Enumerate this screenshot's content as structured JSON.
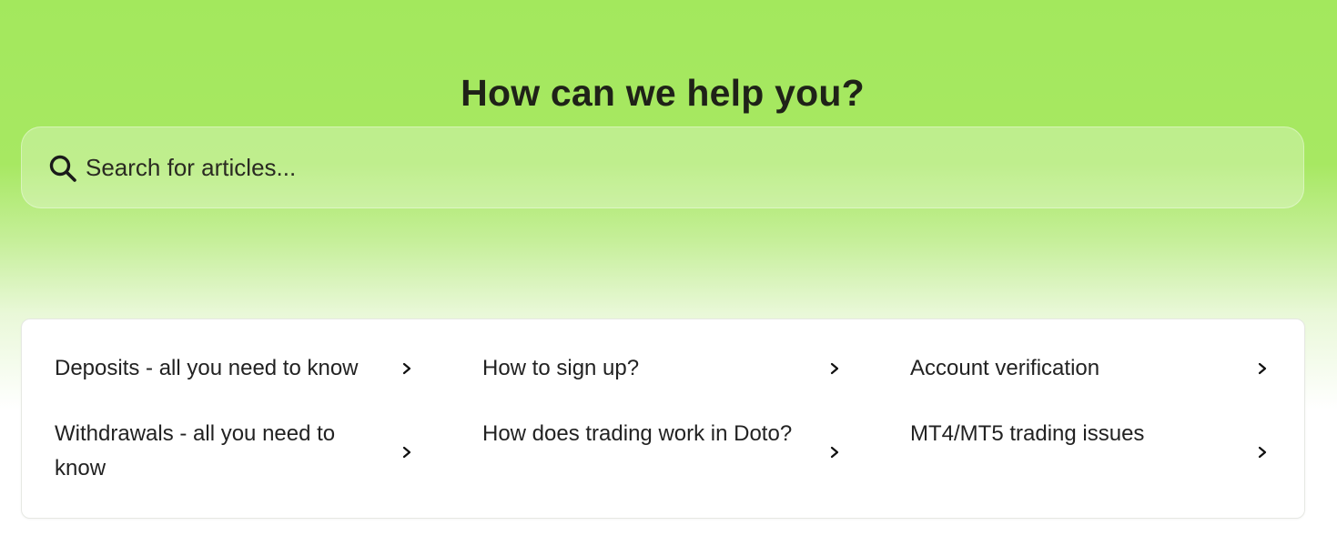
{
  "hero": {
    "title": "How can we help you?"
  },
  "search": {
    "placeholder": "Search for articles...",
    "value": "",
    "icon": "search-icon"
  },
  "articles": [
    {
      "title": "Deposits - all you need to know",
      "icon": "chevron-right-icon"
    },
    {
      "title": "How to sign up?",
      "icon": "chevron-right-icon"
    },
    {
      "title": "Account verification",
      "icon": "chevron-right-icon"
    },
    {
      "title": "Withdrawals - all you need to know",
      "icon": "chevron-right-icon"
    },
    {
      "title": "How does trading work in Doto?",
      "icon": "chevron-right-icon"
    },
    {
      "title": "MT4/MT5 trading issues",
      "icon": "chevron-right-icon"
    }
  ],
  "colors": {
    "hero_green": "#a3e85d",
    "text_dark": "#1f2218",
    "card_background": "#ffffff"
  }
}
